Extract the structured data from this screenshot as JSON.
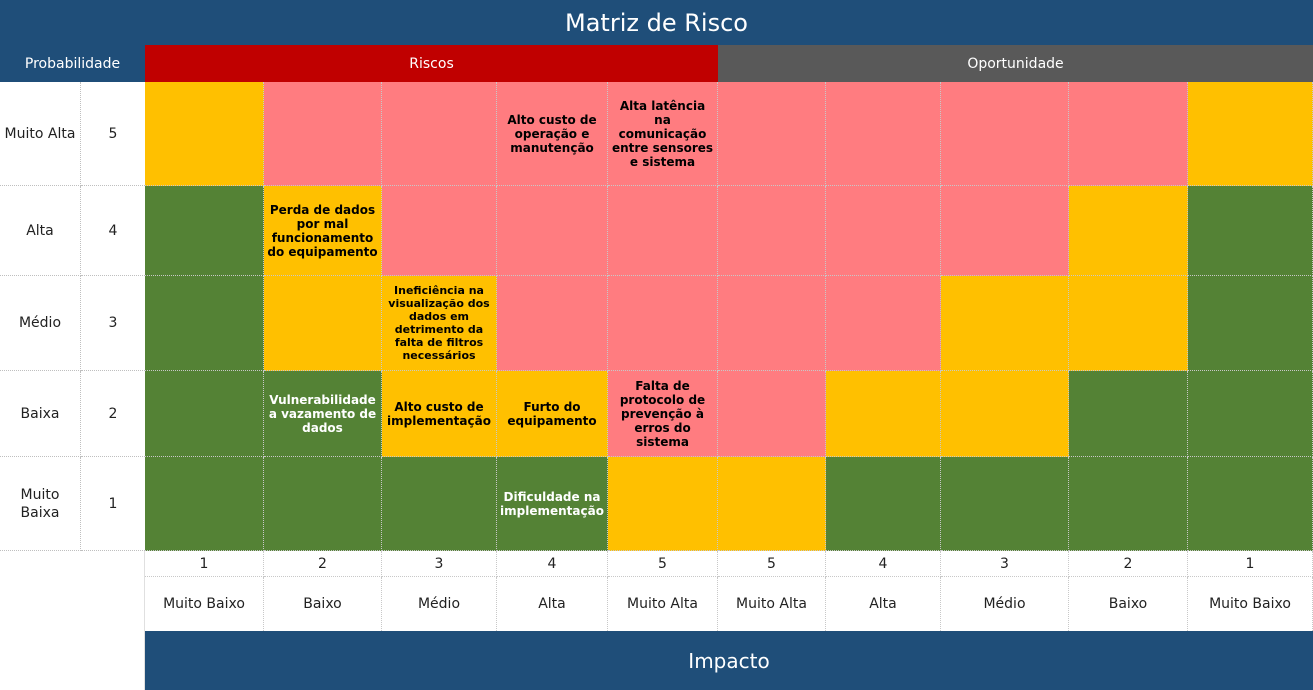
{
  "title": "Matriz de Risco",
  "header": {
    "probability": "Probabilidade",
    "risks": "Riscos",
    "opportunity": "Oportunidade"
  },
  "rows": [
    {
      "label": "Muito Alta",
      "num": "5"
    },
    {
      "label": "Alta",
      "num": "4"
    },
    {
      "label": "Médio",
      "num": "3"
    },
    {
      "label": "Baixa",
      "num": "2"
    },
    {
      "label": "Muito Baixa",
      "num": "1"
    }
  ],
  "grid": [
    [
      "y",
      "r",
      "r",
      "r",
      "r",
      "r",
      "r",
      "r",
      "r",
      "y"
    ],
    [
      "g",
      "y",
      "r",
      "r",
      "r",
      "r",
      "r",
      "r",
      "y",
      "g"
    ],
    [
      "g",
      "y",
      "y",
      "r",
      "r",
      "r",
      "r",
      "y",
      "y",
      "g"
    ],
    [
      "g",
      "g",
      "y",
      "y",
      "r",
      "r",
      "y",
      "y",
      "g",
      "g"
    ],
    [
      "g",
      "g",
      "g",
      "g",
      "y",
      "y",
      "g",
      "g",
      "g",
      "g"
    ]
  ],
  "items": {
    "r5_c4": "Alto custo de operação e manutenção",
    "r5_c5": "Alta latência na comunicação entre sensores e sistema",
    "r4_c2": "Perda de dados por mal funcionamento do equipamento",
    "r3_c3": "Ineficiência na visualização dos dados em detrimento da falta de filtros necessários",
    "r2_c2": "Vulnerabilidade a vazamento de dados",
    "r2_c3": "Alto custo de implementação",
    "r2_c4": "Furto do equipamento",
    "r2_c5": "Falta de protocolo de prevenção à erros do sistema",
    "r1_c4": "Dificuldade na implementação"
  },
  "impact_axis": {
    "numbers": [
      "1",
      "2",
      "3",
      "4",
      "5",
      "5",
      "4",
      "3",
      "2",
      "1"
    ],
    "labels": [
      "Muito Baixo",
      "Baixo",
      "Médio",
      "Alta",
      "Muito Alta",
      "Muito Alta",
      "Alta",
      "Médio",
      "Baixo",
      "Muito Baixo"
    ],
    "title": "Impacto"
  },
  "colors": {
    "header_blue": "#1f4e79",
    "risk_red": "#c00000",
    "opportunity_gray": "#595959",
    "yellow": "#ffc000",
    "pink": "#ff7c80",
    "green": "#548235"
  }
}
